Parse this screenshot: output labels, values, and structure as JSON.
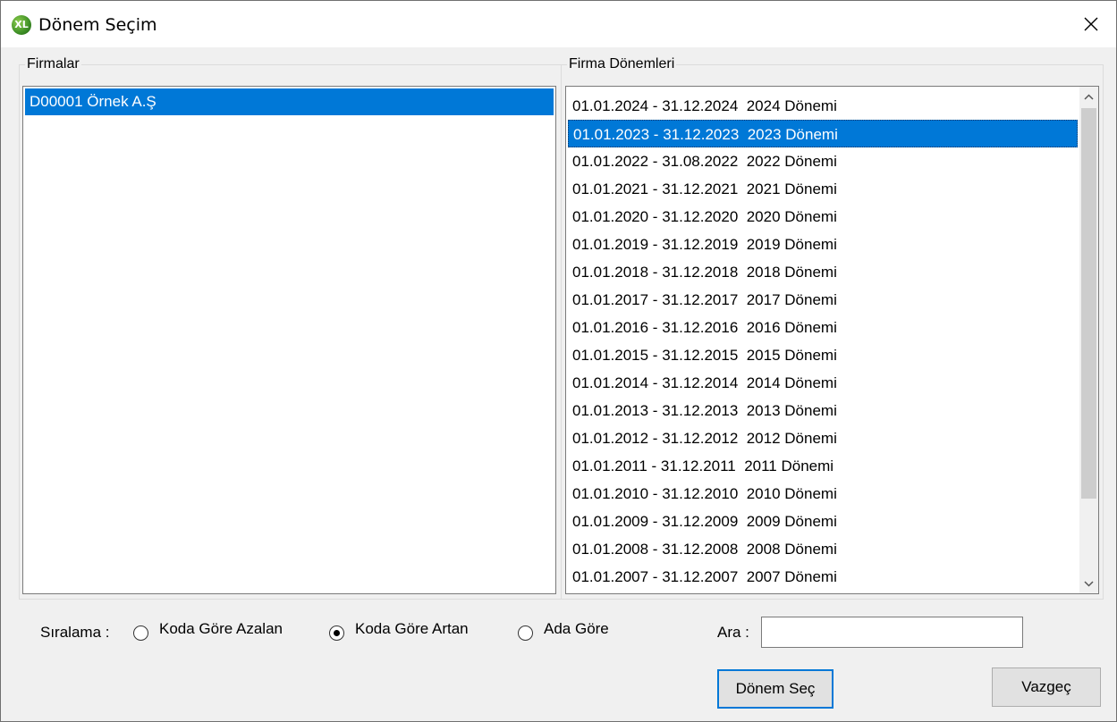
{
  "window": {
    "title": "Dönem Seçim",
    "app_icon_text": "XL"
  },
  "firms": {
    "legend": "Firmalar",
    "items": [
      "D00001 Örnek A.Ş"
    ],
    "selected_index": 0
  },
  "periods": {
    "legend": "Firma Dönemleri",
    "items": [
      "01.01.2024 - 31.12.2024  2024 Dönemi",
      "01.01.2023 - 31.12.2023  2023 Dönemi",
      "01.01.2022 - 31.08.2022  2022 Dönemi",
      "01.01.2021 - 31.12.2021  2021 Dönemi",
      "01.01.2020 - 31.12.2020  2020 Dönemi",
      "01.01.2019 - 31.12.2019  2019 Dönemi",
      "01.01.2018 - 31.12.2018  2018 Dönemi",
      "01.01.2017 - 31.12.2017  2017 Dönemi",
      "01.01.2016 - 31.12.2016  2016 Dönemi",
      "01.01.2015 - 31.12.2015  2015 Dönemi",
      "01.01.2014 - 31.12.2014  2014 Dönemi",
      "01.01.2013 - 31.12.2013  2013 Dönemi",
      "01.01.2012 - 31.12.2012  2012 Dönemi",
      "01.01.2011 - 31.12.2011  2011 Dönemi",
      "01.01.2010 - 31.12.2010  2010 Dönemi",
      "01.01.2009 - 31.12.2009  2009 Dönemi",
      "01.01.2008 - 31.12.2008  2008 Dönemi",
      "01.01.2007 - 31.12.2007  2007 Dönemi"
    ],
    "selected_index": 1
  },
  "sort": {
    "label": "Sıralama :",
    "options": [
      "Koda Göre Azalan",
      "Koda Göre Artan",
      "Ada Göre"
    ],
    "selected_index": 1
  },
  "search": {
    "label": "Ara :",
    "value": ""
  },
  "buttons": {
    "select_label": "Dönem Seç",
    "cancel_label": "Vazgeç"
  },
  "colors": {
    "selection": "#0078d7",
    "background": "#f0f0f0"
  }
}
